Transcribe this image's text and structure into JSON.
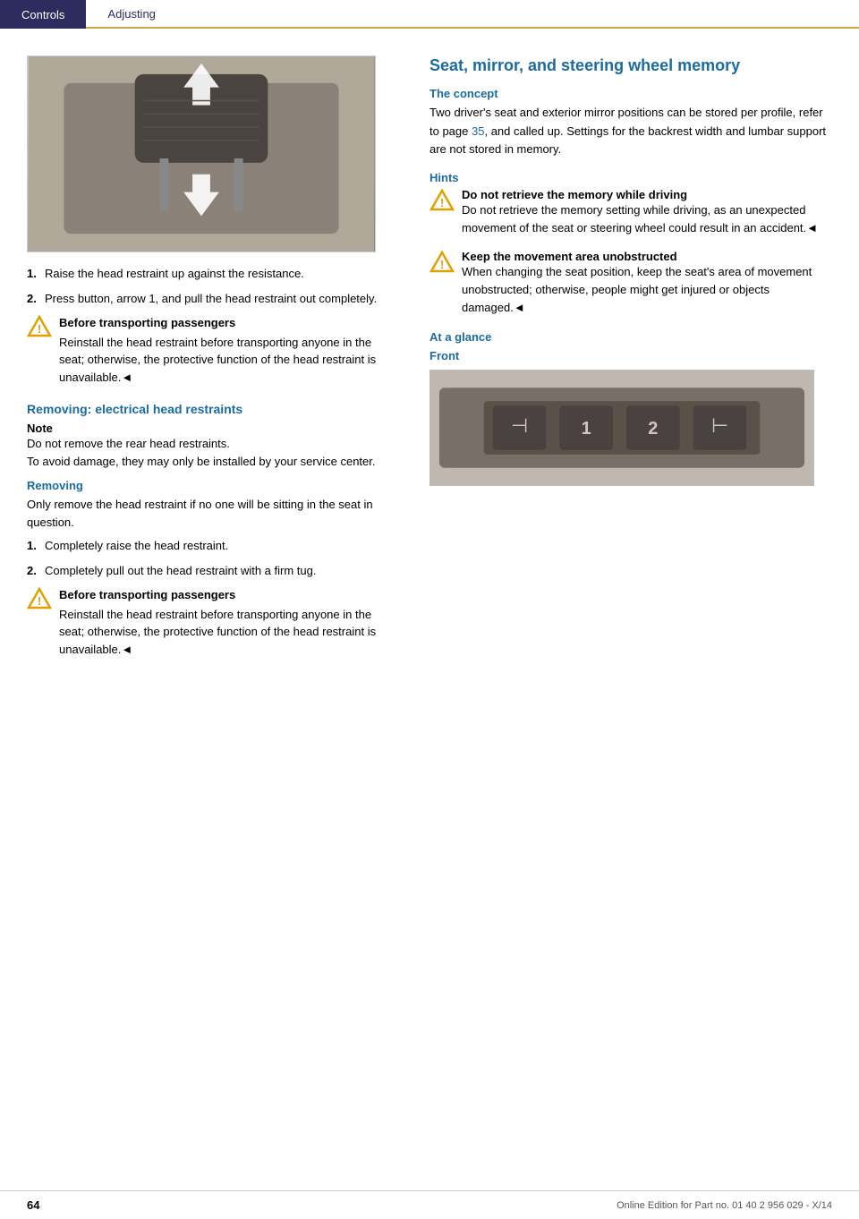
{
  "header": {
    "controls_label": "Controls",
    "adjusting_label": "Adjusting"
  },
  "left_col": {
    "steps_initial": [
      {
        "num": "1.",
        "text": "Raise the head restraint up against the resistance."
      },
      {
        "num": "2.",
        "text": "Press button, arrow 1, and pull the head restraint out completely."
      }
    ],
    "warning1_title": "Before transporting passengers",
    "warning1_text": "Reinstall the head restraint before transporting anyone in the seat; otherwise, the protective function of the head restraint is unavailable.◄",
    "section_electrical": "Removing: electrical head restraints",
    "note_label": "Note",
    "note_text1": "Do not remove the rear head restraints.",
    "note_text2": "To avoid damage, they may only be installed by your service center.",
    "removing_label": "Removing",
    "removing_intro": "Only remove the head restraint if no one will be sitting in the seat in question.",
    "steps_removing": [
      {
        "num": "1.",
        "text": "Completely raise the head restraint."
      },
      {
        "num": "2.",
        "text": "Completely pull out the head restraint with a firm tug."
      }
    ],
    "warning2_title": "Before transporting passengers",
    "warning2_text": "Reinstall the head restraint before transporting anyone in the seat; otherwise, the protective function of the head restraint is unavailable.◄"
  },
  "right_col": {
    "section_title": "Seat, mirror, and steering wheel memory",
    "concept_title": "The concept",
    "concept_text": "Two driver's seat and exterior mirror positions can be stored per profile, refer to page 35, and called up. Settings for the backrest width and lumbar support are not stored in memory.",
    "page_link": "35",
    "hints_title": "Hints",
    "hint1_title": "Do not retrieve the memory while driving",
    "hint1_text": "Do not retrieve the memory setting while driving, as an unexpected movement of the seat or steering wheel could result in an accident.◄",
    "hint2_title": "Keep the movement area unobstructed",
    "hint2_text": "When changing the seat position, keep the seat's area of movement unobstructed; otherwise, people might get injured or objects damaged.◄",
    "at_a_glance_title": "At a glance",
    "front_label": "Front"
  },
  "footer": {
    "page_number": "64",
    "edition_text": "Online Edition for Part no. 01 40 2 956 029 - X/14"
  }
}
